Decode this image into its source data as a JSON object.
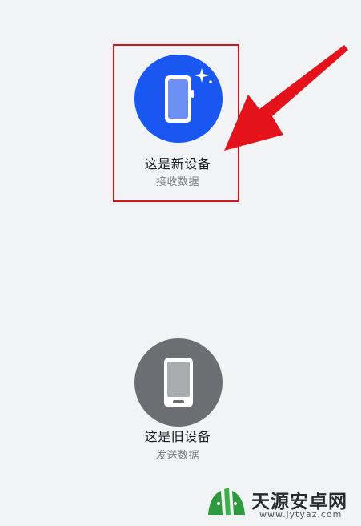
{
  "options": {
    "new_device": {
      "title": "这是新设备",
      "subtitle": "接收数据",
      "icon": "new-phone-icon",
      "color": "#1a56f0"
    },
    "old_device": {
      "title": "这是旧设备",
      "subtitle": "发送数据",
      "icon": "old-phone-icon",
      "color": "#6c6e73"
    }
  },
  "annotation": {
    "highlight_color": "#d3141c",
    "arrow_color": "#e3121b"
  },
  "watermark": {
    "name": "天源安卓网",
    "url": "www.jytyaz.com"
  }
}
